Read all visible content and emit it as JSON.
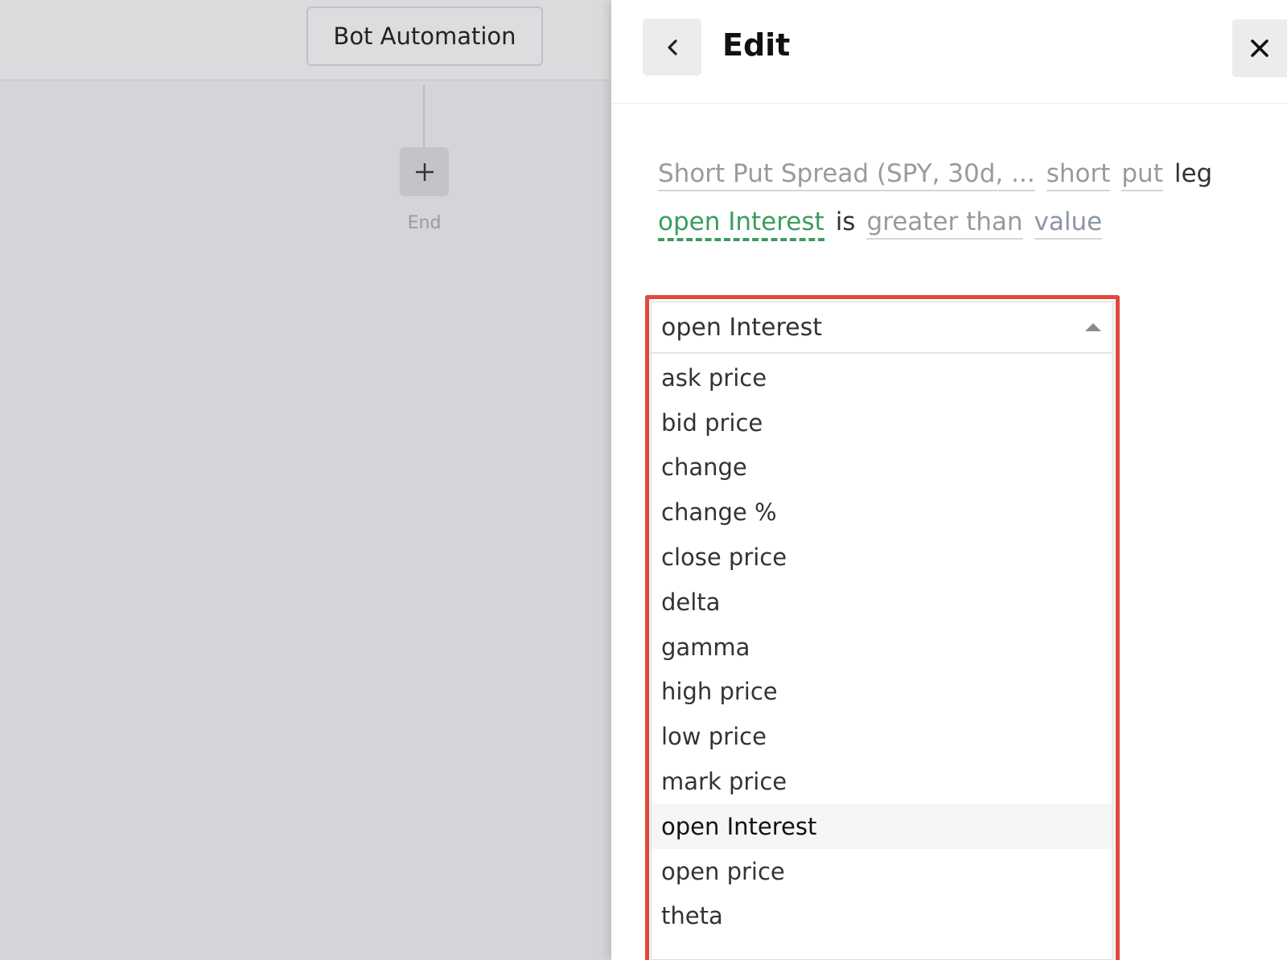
{
  "canvas": {
    "bot_button_label": "Bot Automation",
    "end_label": "End"
  },
  "panel": {
    "title": "Edit",
    "back_icon": "chevron-left-icon",
    "close_icon": "close-icon"
  },
  "sentence": {
    "strategy": "Short Put Spread (SPY, 30d, ...",
    "leg_side": "short",
    "leg_type": "put",
    "leg_word": "leg",
    "field": "open Interest",
    "is_word": "is",
    "operator": "greater than",
    "value": "value"
  },
  "dropdown": {
    "selected": "open Interest",
    "options": [
      "ask price",
      "bid price",
      "change",
      "change %",
      "close price",
      "delta",
      "gamma",
      "high price",
      "low price",
      "mark price",
      "open Interest",
      "open price",
      "theta"
    ],
    "active_index": 10
  },
  "colors": {
    "highlight_border": "#e04a3e",
    "field_green": "#3a9d5c",
    "value_blue_gray": "#8b95a3"
  }
}
